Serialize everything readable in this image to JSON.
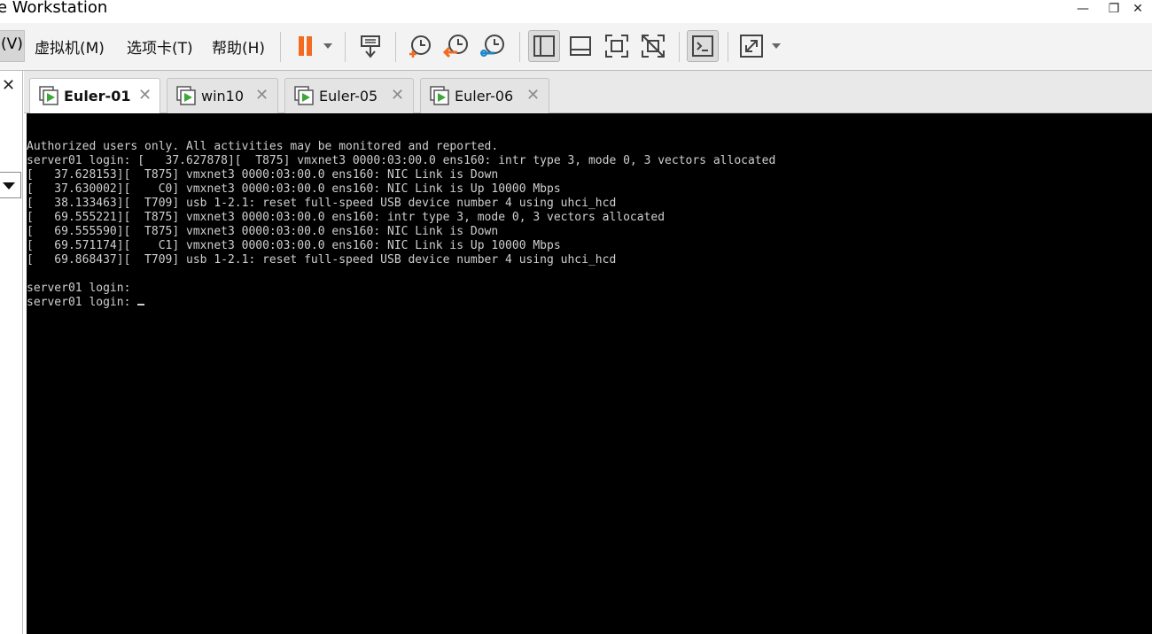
{
  "window": {
    "title": "e Workstation",
    "minimize_glyph": "—",
    "restore_glyph": "❐",
    "close_glyph": "✕"
  },
  "menu": {
    "partial_item": "(V)",
    "items": [
      {
        "label": "虚拟机(M)"
      },
      {
        "label": "选项卡(T)"
      },
      {
        "label": "帮助(H)"
      }
    ]
  },
  "toolbar": {
    "icons": [
      "pause-icon",
      "send-ctrl-alt-del-icon",
      "take-snapshot-icon",
      "revert-snapshot-icon",
      "snapshot-manager-icon",
      "show-library-icon",
      "thumbnail-bar-icon",
      "full-screen-icon",
      "unity-icon",
      "console-view-icon",
      "stretch-guest-icon"
    ],
    "accent_color": "#f26b21"
  },
  "sidebar": {
    "close_glyph": "✕"
  },
  "tabs": [
    {
      "label": "Euler-01",
      "active": true
    },
    {
      "label": "win10",
      "active": false
    },
    {
      "label": "Euler-05",
      "active": false
    },
    {
      "label": "Euler-06",
      "active": false
    }
  ],
  "tab_close_glyph": "✕",
  "console": {
    "lines": [
      "Authorized users only. All activities may be monitored and reported.",
      "server01 login: [   37.627878][  T875] vmxnet3 0000:03:00.0 ens160: intr type 3, mode 0, 3 vectors allocated",
      "[   37.628153][  T875] vmxnet3 0000:03:00.0 ens160: NIC Link is Down",
      "[   37.630002][    C0] vmxnet3 0000:03:00.0 ens160: NIC Link is Up 10000 Mbps",
      "[   38.133463][  T709] usb 1-2.1: reset full-speed USB device number 4 using uhci_hcd",
      "[   69.555221][  T875] vmxnet3 0000:03:00.0 ens160: intr type 3, mode 0, 3 vectors allocated",
      "[   69.555590][  T875] vmxnet3 0000:03:00.0 ens160: NIC Link is Down",
      "[   69.571174][    C1] vmxnet3 0000:03:00.0 ens160: NIC Link is Up 10000 Mbps",
      "[   69.868437][  T709] usb 1-2.1: reset full-speed USB device number 4 using uhci_hcd",
      "",
      "server01 login:",
      "server01 login: "
    ],
    "background": "#000000",
    "foreground": "#cfcfcf"
  }
}
